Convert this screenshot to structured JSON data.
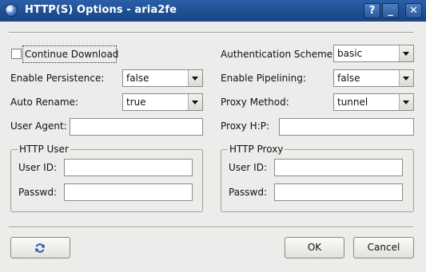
{
  "window": {
    "title": "HTTP(S) Options - aria2fe",
    "help_glyph": "?",
    "minimize_glyph": "_",
    "close_glyph": "✕"
  },
  "form": {
    "continue_download": {
      "label": "Continue Download",
      "checked": false
    },
    "enable_persistence": {
      "label": "Enable Persistence:",
      "value": "false"
    },
    "auto_rename": {
      "label": "Auto Rename:",
      "value": "true"
    },
    "user_agent": {
      "label": "User Agent:",
      "value": ""
    },
    "authentication_scheme": {
      "label": "Authentication Scheme:",
      "value": "basic"
    },
    "enable_pipelining": {
      "label": "Enable Pipelining:",
      "value": "false"
    },
    "proxy_method": {
      "label": "Proxy Method:",
      "value": "tunnel"
    },
    "proxy_host_port": {
      "label": "Proxy H:P:",
      "value": ""
    }
  },
  "http_user": {
    "title": "HTTP User",
    "user_id_label": "User ID:",
    "user_id_value": "",
    "passwd_label": "Passwd:",
    "passwd_value": ""
  },
  "http_proxy": {
    "title": "HTTP Proxy",
    "user_id_label": "User ID:",
    "user_id_value": "",
    "passwd_label": "Passwd:",
    "passwd_value": ""
  },
  "buttons": {
    "ok": "OK",
    "cancel": "Cancel",
    "refresh_icon": "refresh-icon"
  },
  "colors": {
    "titlebar": "#1f4f93",
    "window_bg": "#edecea"
  }
}
